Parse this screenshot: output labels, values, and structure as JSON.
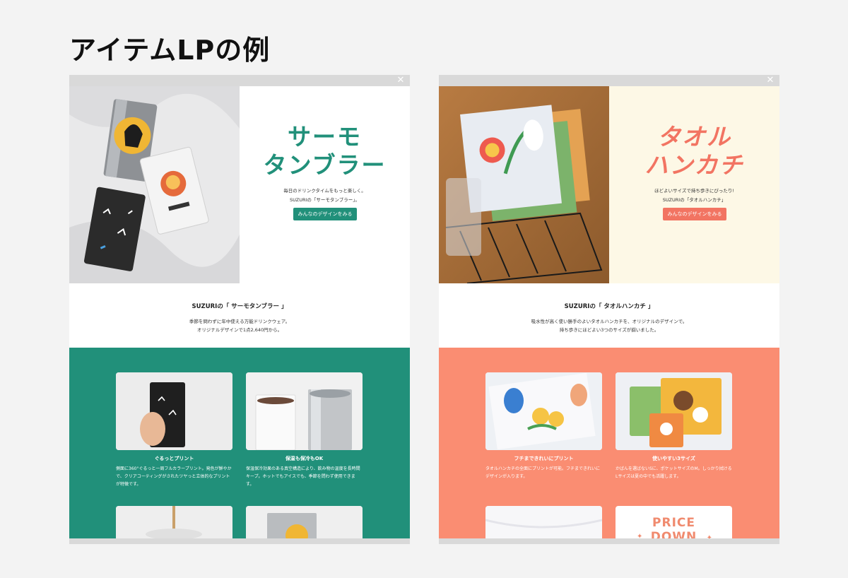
{
  "page": {
    "title": "アイテムLPの例"
  },
  "colors": {
    "thermo_green": "#21907a",
    "towel_coral": "#fa8d72",
    "towel_cream": "#fdf8e6",
    "towel_title": "#f27462"
  },
  "icons": {
    "close": "close-icon"
  },
  "thermo": {
    "hero": {
      "title_line1": "サーモ",
      "title_line2": "タンブラー",
      "desc_line1": "毎日のドリンクタイムをもっと楽しく。",
      "desc_line2": "SUZURIの「サーモタンブラー」。",
      "cta": "みんなのデザインをみる"
    },
    "intro": {
      "title": "SUZURIの「 サーモタンブラー 」",
      "desc_line1": "季節を問わずに年中使える万能ドリンクウェア。",
      "desc_line2": "オリジナルデザインで1点2,640円から。"
    },
    "features": [
      {
        "title": "ぐるっとプリント",
        "desc": "側面に360°ぐるっと一周フルカラープリント。発色が鮮やかで、クリアコーティングがされたツヤっと立体的なプリントが特徴です。"
      },
      {
        "title": "保温も保冷もOK",
        "desc": "保温保冷効果のある真空構造により、飲み物の温度を長時間キープ。ホットでもアイスでも、季節を問わず使用できます。"
      }
    ]
  },
  "towel": {
    "hero": {
      "title_line1": "タオル",
      "title_line2": "ハンカチ",
      "desc_line1": "ほどよいサイズで持ち歩きにぴったり!",
      "desc_line2": "SUZURIの「タオルハンカチ」",
      "cta": "みんなのデザインをみる"
    },
    "intro": {
      "title": "SUZURIの「 タオルハンカチ 」",
      "desc_line1": "吸水性が高く使い勝手のよいタオルハンカチを、オリジナルのデザインで。",
      "desc_line2": "持ち歩きにほどよい3つのサイズが揃いました。"
    },
    "features": [
      {
        "title": "フチまできれいにプリント",
        "desc": "タオルハンカチの全面にプリントが可能。フチまできれいにデザインが入ります。"
      },
      {
        "title": "使いやすい3サイズ",
        "desc": "かばんを選ばないSに、ポケットサイズのM。しっかり拭けるLサイズは夏の中でも活躍します。"
      }
    ],
    "price_badge": {
      "line1": "PRICE",
      "line2": "DOWN"
    }
  }
}
